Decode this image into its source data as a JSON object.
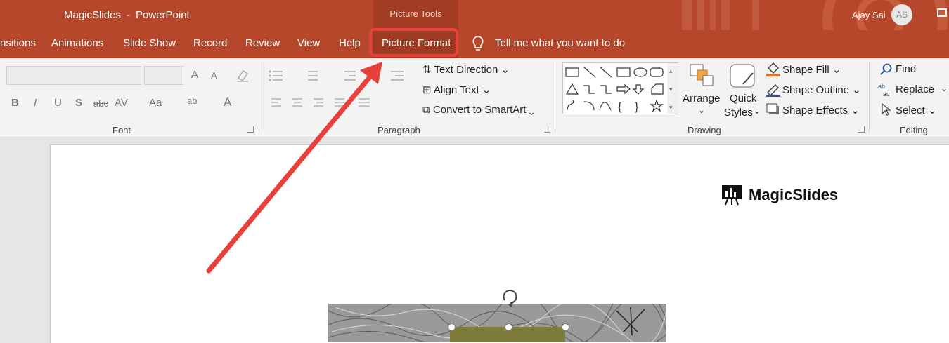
{
  "title": {
    "doc": "MagicSlides",
    "sep": "-",
    "app": "PowerPoint"
  },
  "context_group": "Picture Tools",
  "user": {
    "name": "Ajay Sai",
    "initials": "AS"
  },
  "tabs": [
    "nsitions",
    "Animations",
    "Slide Show",
    "Record",
    "Review",
    "View",
    "Help",
    "Picture Format"
  ],
  "tell_me": "Tell me what you want to do",
  "ribbon": {
    "font": {
      "label": "Font",
      "bold": "B",
      "italic": "I",
      "underline": "U",
      "shadow": "S",
      "strike": "abc",
      "spacing": "AV",
      "case": "Aa",
      "highlight": "ab",
      "color": "A",
      "grow": "A",
      "shrink": "A"
    },
    "paragraph": {
      "label": "Paragraph",
      "text_direction": "Text Direction",
      "align_text": "Align Text",
      "smartart": "Convert to SmartArt"
    },
    "drawing": {
      "label": "Drawing",
      "arrange": "Arrange",
      "quick_styles_1": "Quick",
      "quick_styles_2": "Styles",
      "shape_fill": "Shape Fill",
      "shape_outline": "Shape Outline",
      "shape_effects": "Shape Effects"
    },
    "editing": {
      "label": "Editing",
      "find": "Find",
      "replace": "Replace",
      "select": "Select"
    }
  },
  "slide": {
    "logo_text": "MagicSlides"
  },
  "colors": {
    "accent": "#b7472a",
    "highlight": "#e8403a"
  }
}
